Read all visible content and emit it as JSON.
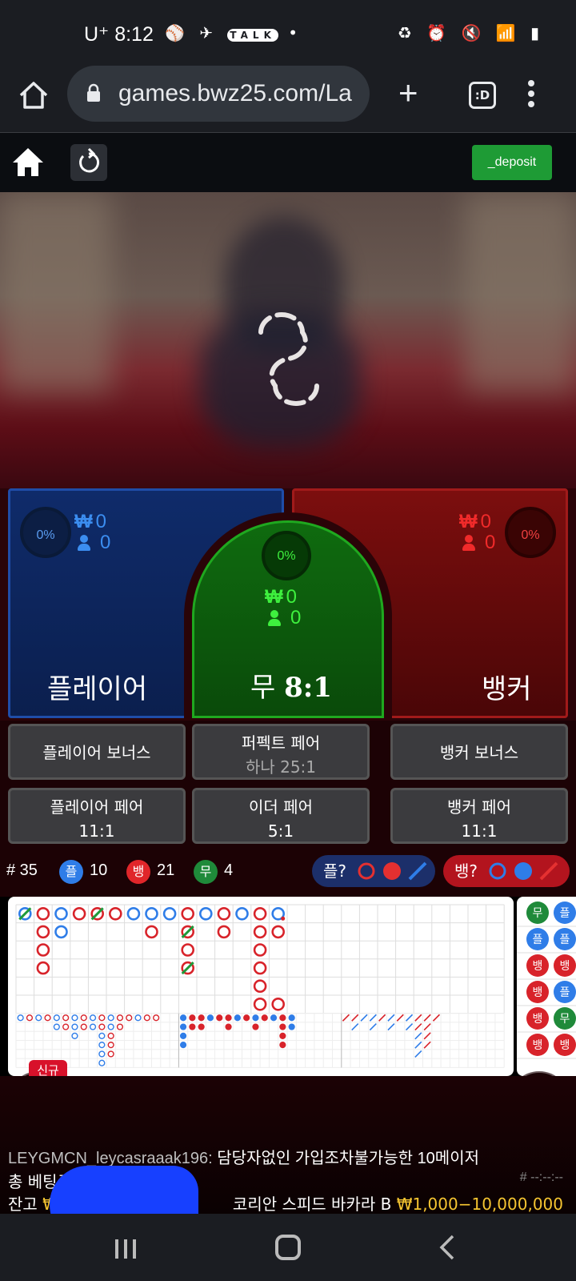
{
  "status_bar": {
    "carrier": "U⁺",
    "time": "8:12",
    "notification_icons": [
      "baseball-icon",
      "telegram-icon",
      "kakaotalk-icon",
      "dot-icon"
    ],
    "system_icons": [
      "battery-saver-icon",
      "alarm-icon",
      "mute-icon",
      "wifi-icon",
      "signal-icon",
      "battery-icon"
    ]
  },
  "browser": {
    "url": "games.bwz25.com/La",
    "tabs_label": ":D"
  },
  "site_header": {
    "deposit_label": "_deposit"
  },
  "bets": {
    "player": {
      "percent": "0%",
      "amount": "0",
      "count": "0",
      "label": "플레이어"
    },
    "tie": {
      "percent": "0%",
      "amount": "0",
      "count": "0",
      "label": "무",
      "odds": "8:1"
    },
    "banker": {
      "percent": "0%",
      "amount": "0",
      "count": "0",
      "label": "뱅커"
    },
    "currency": "₩"
  },
  "side_bets": [
    {
      "line1": "플레이어 보너스",
      "line2": ""
    },
    {
      "line1": "퍼펙트 페어",
      "line2": "하나 25:1"
    },
    {
      "line1": "뱅커 보너스",
      "line2": ""
    },
    {
      "line1": "플레이어 페어",
      "line2": "11:1"
    },
    {
      "line1": "이더 페어",
      "line2": "5:1"
    },
    {
      "line1": "뱅커 페어",
      "line2": "11:1"
    }
  ],
  "stats": {
    "round": "# 35",
    "player_short": "플",
    "player_count": "10",
    "banker_short": "뱅",
    "banker_count": "21",
    "tie_short": "무",
    "tie_count": "4",
    "player_predict": "플?",
    "banker_predict": "뱅?"
  },
  "side_road": [
    "무",
    "플",
    "뱅",
    "뱅",
    "뱅",
    "뱅"
  ],
  "side_road_partial": [
    "플",
    "플",
    "뱅",
    "플",
    "무",
    "뱅"
  ],
  "new_badge": "신규",
  "chat": {
    "user": "LEYGMCN_leycasraaak196:",
    "message": "담당자없인 가입조차불가능한 10메이저"
  },
  "footer": {
    "total_bet_label": "총 베팅금",
    "total_bet_value": "₩",
    "balance_label": "잔고",
    "balance_value": "₩",
    "round_id": "# --:--:--",
    "table_name": "코리안 스피드 바카라 B",
    "limits": "₩1,000−10,000,000"
  },
  "colors": {
    "player": "#1f4da8",
    "banker": "#a11a1a",
    "tie": "#1fa81f",
    "deposit": "#1e9b35",
    "gold": "#f5c531"
  }
}
